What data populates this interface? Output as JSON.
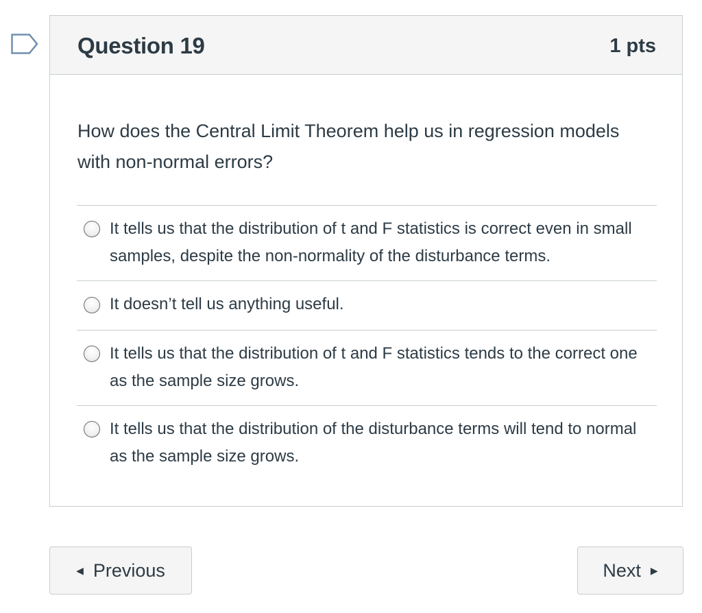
{
  "question": {
    "title": "Question 19",
    "points": "1 pts",
    "text": "How does the Central Limit Theorem help us in regression models with non-normal errors?",
    "answers": [
      {
        "label": "It tells us that the distribution of t and F statistics is correct even in small samples, despite the non-normality of the disturbance terms.",
        "selected": false
      },
      {
        "label": "It doesn’t tell us anything useful.",
        "selected": false
      },
      {
        "label": "It tells us that the distribution of t and F statistics tends to the correct one as the sample size grows.",
        "selected": false
      },
      {
        "label": "It tells us that the distribution of the disturbance terms will tend to normal as the sample size grows.",
        "selected": false
      }
    ]
  },
  "navigation": {
    "previous_label": "Previous",
    "next_label": "Next",
    "previous_icon": "triangle-left-icon",
    "next_icon": "triangle-right-icon"
  },
  "flag_icon": "flag-marker-icon",
  "colors": {
    "text": "#2d3b45",
    "border": "#c7cdd1",
    "header_bg": "#f5f5f5",
    "flag_stroke": "#6f8fae"
  }
}
